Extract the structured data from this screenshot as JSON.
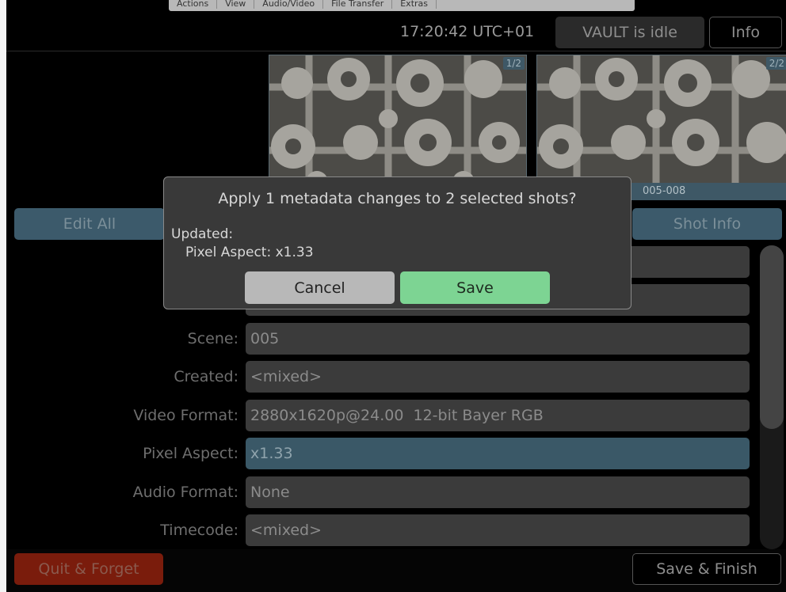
{
  "menu": {
    "items": [
      "Actions",
      "View",
      "Audio/Video",
      "File Transfer",
      "Extras"
    ]
  },
  "header": {
    "clock": "17:20:42 UTC+01",
    "status_button": "VAULT is idle",
    "info_button": "Info"
  },
  "thumbnails": [
    {
      "counter": "1/2"
    },
    {
      "counter": "2/2",
      "label": "005-008"
    }
  ],
  "buttons": {
    "edit_all": "Edit All",
    "shot_info": "Shot Info",
    "quit": "Quit & Forget",
    "save_finish": "Save & Finish"
  },
  "fields": [
    {
      "label": "Scene:",
      "value": "005"
    },
    {
      "label": "Created:",
      "value": "<mixed>"
    },
    {
      "label": "Video Format:",
      "value": "2880x1620p@24.00  12-bit Bayer RGB"
    },
    {
      "label": "Pixel Aspect:",
      "value": "x1.33"
    },
    {
      "label": "Audio Format:",
      "value": "None"
    },
    {
      "label": "Timecode:",
      "value": "<mixed>"
    }
  ],
  "dialog": {
    "title": "Apply 1 metadata changes to 2 selected shots?",
    "updated_label": "Updated:",
    "change": "Pixel Aspect: x1.33",
    "cancel": "Cancel",
    "save": "Save"
  },
  "colors": {
    "accent": "#3c5a6b",
    "save_green": "#7dd493",
    "quit_red": "#7a1c0c",
    "background": "#000000"
  }
}
